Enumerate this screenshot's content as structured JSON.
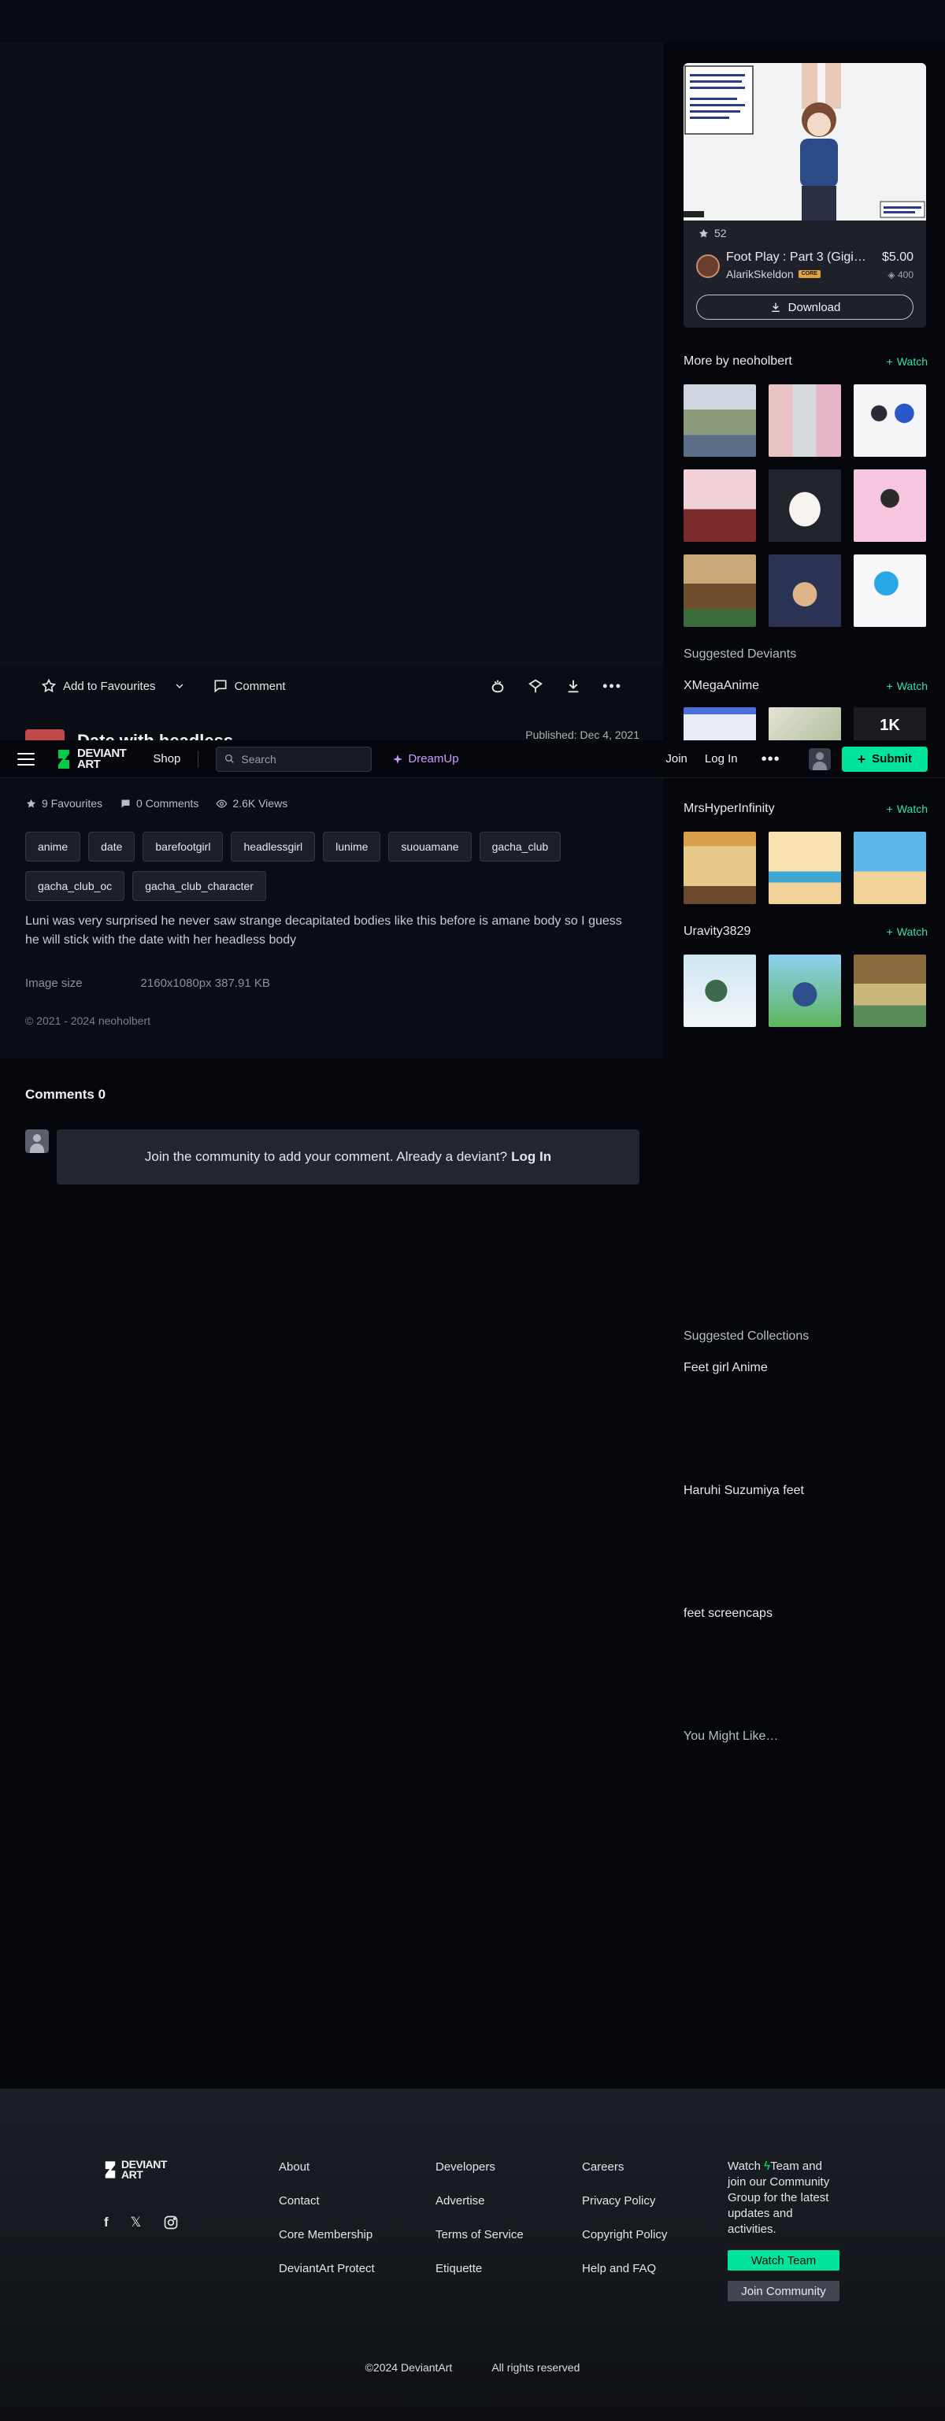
{
  "actions": {
    "add_to_favourites": "Add to Favourites",
    "comment": "Comment"
  },
  "deviation": {
    "title": "Date with headless",
    "published": "Published: Dec 4, 2021",
    "favourites": "9 Favourites",
    "comments": "0 Comments",
    "views": "2.6K Views",
    "tags": [
      "anime",
      "date",
      "barefootgirl",
      "headlessgirl",
      "lunime",
      "suouamane",
      "gacha_club",
      "gacha_club_oc",
      "gacha_club_character"
    ],
    "description": "Luni was very surprised he never saw strange decapitated bodies like this before is amane body so I guess he will stick with the date with her headless body",
    "image_size_label": "Image size",
    "image_size_value": "2160x1080px 387.91 KB",
    "copyright": "© 2021 - 2024 neoholbert"
  },
  "header": {
    "logo_line1": "DEVIANT",
    "logo_line2": "ART",
    "shop": "Shop",
    "search_placeholder": "Search",
    "dreamup": "DreamUp",
    "join": "Join",
    "login": "Log In",
    "more": "•••",
    "submit": "Submit"
  },
  "comments": {
    "title": "Comments 0",
    "join_text": "Join the community to add your comment. Already a deviant?",
    "login": "Log In"
  },
  "product": {
    "likes": "52",
    "title": "Foot Play : Part 3 (Gigi C...",
    "price": "$5.00",
    "author": "AlarikSkeldon",
    "badge": "CORE",
    "points": "400",
    "download": "Download"
  },
  "sidebar": {
    "more_by": "More by neoholbert",
    "watch": "Watch",
    "suggested_deviants": "Suggested Deviants",
    "deviants": [
      "XMegaAnime",
      "MrsHyperInfinity",
      "Uravity3829"
    ],
    "thumb_text": "1K",
    "suggested_collections": "Suggested Collections",
    "collections": [
      "Feet girl Anime",
      "Haruhi Suzumiya feet",
      "feet screencaps"
    ],
    "you_might_like": "You Might Like…"
  },
  "footer": {
    "logo_line1": "DEVIANT",
    "logo_line2": "ART",
    "col1": [
      "About",
      "Contact",
      "Core Membership",
      "DeviantArt Protect"
    ],
    "col2": [
      "Developers",
      "Advertise",
      "Terms of Service",
      "Etiquette"
    ],
    "col3": [
      "Careers",
      "Privacy Policy",
      "Copyright Policy",
      "Help and FAQ"
    ],
    "watch_text_pre": "Watch",
    "watch_text_post": "Team and join our Community Group for the latest updates and activities.",
    "watch_team": "Watch Team",
    "join_community": "Join Community",
    "copyright": "©2024 DeviantArt",
    "rights": "All rights reserved"
  },
  "colors": {
    "accent": "#00e59b",
    "watch_green": "#39e0a0",
    "dreamup_purple": "#c89cff",
    "background": "#06070d"
  }
}
